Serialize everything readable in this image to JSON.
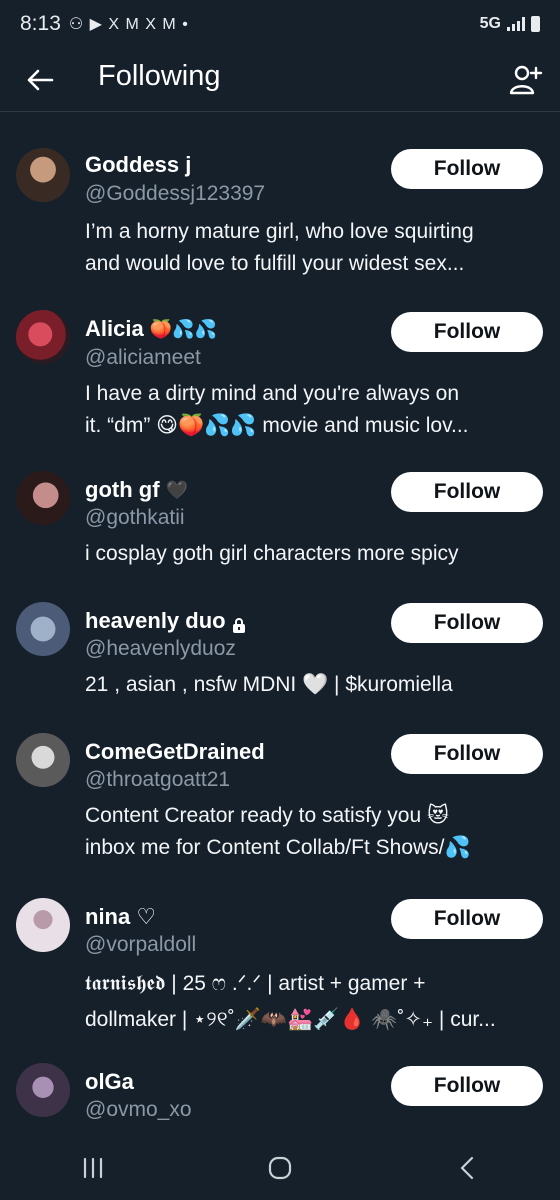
{
  "status": {
    "time": "8:13",
    "app_icons": "⚇ ▶ X M X M •",
    "network": "5G"
  },
  "header": {
    "title": "Following"
  },
  "accounts": [
    {
      "name": "Goddess j",
      "badge": "",
      "handle": "@Goddessj123397",
      "bio_lines": [
        "I’m a horny mature girl, who love squirting",
        "and would love to fulfill your widest sex..."
      ],
      "follow_label": "Follow",
      "avatar_colors": [
        "#3a2a24",
        "#c69a7d"
      ]
    },
    {
      "name": "Alicia",
      "badge": "🍑💦💦",
      "handle": "@aliciameet",
      "bio_lines": [
        "I have a dirty mind and you're always on",
        "it. “dm” 😋🍑💦💦  movie and music lov..."
      ],
      "follow_label": "Follow",
      "avatar_colors": [
        "#7a1e2a",
        "#d94c5e"
      ]
    },
    {
      "name": "goth gf",
      "badge": "🖤",
      "handle": "@gothkatii",
      "bio_lines": [
        "i cosplay goth girl characters more spicy"
      ],
      "follow_label": "Follow",
      "avatar_colors": [
        "#2b1a1a",
        "#c58c8c"
      ]
    },
    {
      "name": "heavenly duo",
      "badge": "",
      "handle": "@heavenlyduoz",
      "bio_lines": [
        "21 , asian , nsfw MDNI 🤍 | $kuromiella"
      ],
      "follow_label": "Follow",
      "avatar_colors": [
        "#4c5b78",
        "#9fb0c9"
      ]
    },
    {
      "name": "ComeGetDrained",
      "badge": "",
      "handle": "@throatgoatt21",
      "bio_lines": [
        "Content Creator ready to satisfy you 😻",
        "inbox me for Content Collab/Ft Shows/💦"
      ],
      "follow_label": "Follow",
      "avatar_colors": [
        "#5a5a5a",
        "#d9d9d9"
      ]
    },
    {
      "name": "nina ♡",
      "badge": "",
      "handle": "@vorpaldoll",
      "bio_lines": [
        "𝖙𝖆𝖗𝖓𝖎𝖘𝖍𝖊𝖉 | 25 ෆ .ᐟ.ᐟ | artist + gamer +",
        "dollmaker | ⋆୨୧˚🗡️🦇💒💉🩸 🕷️˚✧₊ | cur..."
      ],
      "follow_label": "Follow",
      "avatar_colors": [
        "#e9dfe6",
        "#b89aa8"
      ]
    },
    {
      "name": "olGa",
      "badge": "",
      "handle": "@ovmo_xo",
      "bio_lines": [],
      "follow_label": "Follow",
      "avatar_colors": [
        "#3d3248",
        "#a890b5"
      ]
    }
  ],
  "colors": {
    "background": "#15202b",
    "handle": "#8b98a5",
    "button_bg": "#ffffff",
    "button_text": "#0f1419"
  }
}
